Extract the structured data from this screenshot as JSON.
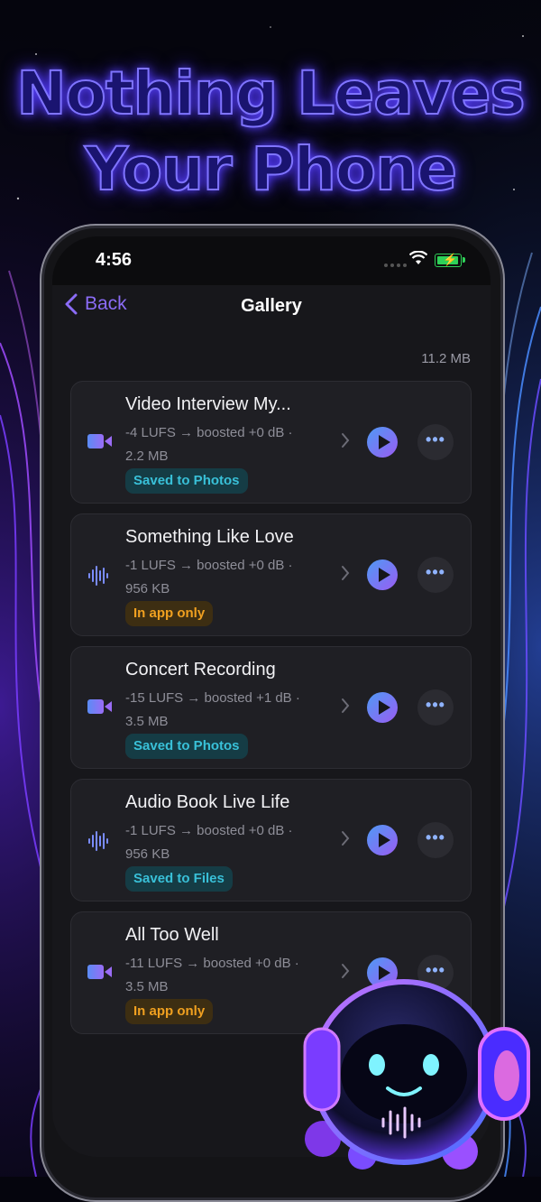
{
  "headline": {
    "line1": "Nothing Leaves",
    "line2": "Your Phone"
  },
  "status_bar": {
    "time": "4:56",
    "signal_icon": "cellular-dots-icon",
    "wifi_icon": "wifi-icon",
    "battery_icon": "battery-charging-icon"
  },
  "nav": {
    "back_label": "Back",
    "title": "Gallery"
  },
  "total_size": "11.2 MB",
  "colors": {
    "accent": "#8b6cf6",
    "badge_blue": "#39c0d8",
    "badge_orange": "#f0a020"
  },
  "items": [
    {
      "type_icon": "video-icon",
      "title": "Video Interview My...",
      "meta_line1": "-4 LUFS → boosted +0 dB ·",
      "meta_line2": "2.2 MB",
      "badge": "Saved to Photos",
      "badge_style": "blue"
    },
    {
      "type_icon": "audio-waveform-icon",
      "title": "Something Like Love",
      "meta_line1": "-1 LUFS → boosted +0 dB ·",
      "meta_line2": "956 KB",
      "badge": "In app only",
      "badge_style": "orange"
    },
    {
      "type_icon": "video-icon",
      "title": "Concert Recording",
      "meta_line1": "-15 LUFS → boosted +1 dB ·",
      "meta_line2": "3.5 MB",
      "badge": "Saved to Photos",
      "badge_style": "blue"
    },
    {
      "type_icon": "audio-waveform-icon",
      "title": "Audio Book Live Life",
      "meta_line1": "-1 LUFS → boosted +0 dB ·",
      "meta_line2": "956 KB",
      "badge": "Saved to Files",
      "badge_style": "blue"
    },
    {
      "type_icon": "video-icon",
      "title": "All Too Well",
      "meta_line1": "-11 LUFS → boosted +0 dB ·",
      "meta_line2": "3.5 MB",
      "badge": "In app only",
      "badge_style": "orange"
    }
  ],
  "more_label": "•••"
}
